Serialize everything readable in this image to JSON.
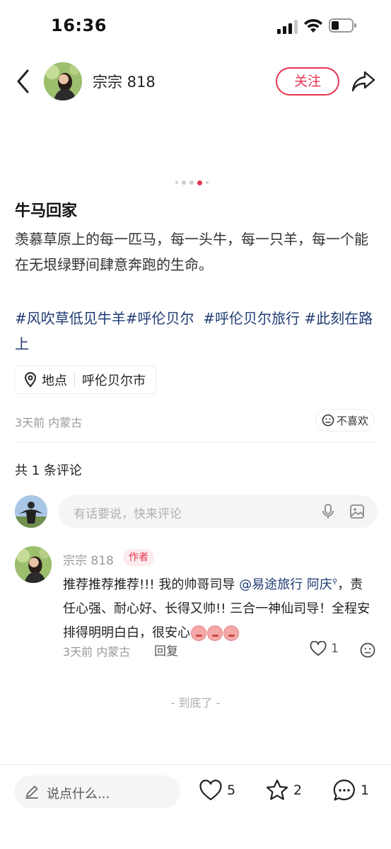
{
  "status_bar": {
    "time": "16:36"
  },
  "header": {
    "author_name": "宗宗 818",
    "follow_label": "关注"
  },
  "post": {
    "title": "牛马回家",
    "body": "羡慕草原上的每一匹马，每一头牛，每一只羊，每一个能在无垠绿野间肆意奔跑的生命。",
    "tags": [
      "#风吹草低见牛羊",
      "#呼伦贝尔",
      "#呼伦贝尔旅行",
      "#此刻在路上"
    ],
    "location_label": "地点",
    "location_value": "呼伦贝尔市",
    "meta": "3天前 内蒙古",
    "dislike_label": "不喜欢",
    "carousel": {
      "total": 5,
      "active_index": 3
    }
  },
  "comments": {
    "count_label": "共 1 条评论",
    "input_placeholder": "有话要说，快来评论",
    "items": [
      {
        "name": "宗宗 818",
        "badge": "作者",
        "text_before": "推荐推荐推荐!!! 我的帅哥司导",
        "mention": "@易途旅行 阿庆",
        "text_after": "，责任心强、耐心好、长得又帅!! 三合一神仙司导！全程安排得明明白白，很安心",
        "meta": "3天前 内蒙古",
        "reply_label": "回复",
        "likes": "1"
      }
    ],
    "end_marker": "- 到底了 -"
  },
  "bottom_bar": {
    "input_placeholder": "说点什么...",
    "likes": "5",
    "collects": "2",
    "comments": "1"
  },
  "colors": {
    "accent": "#e8334f",
    "tag_blue": "#1f3b73",
    "muted": "#999999"
  }
}
